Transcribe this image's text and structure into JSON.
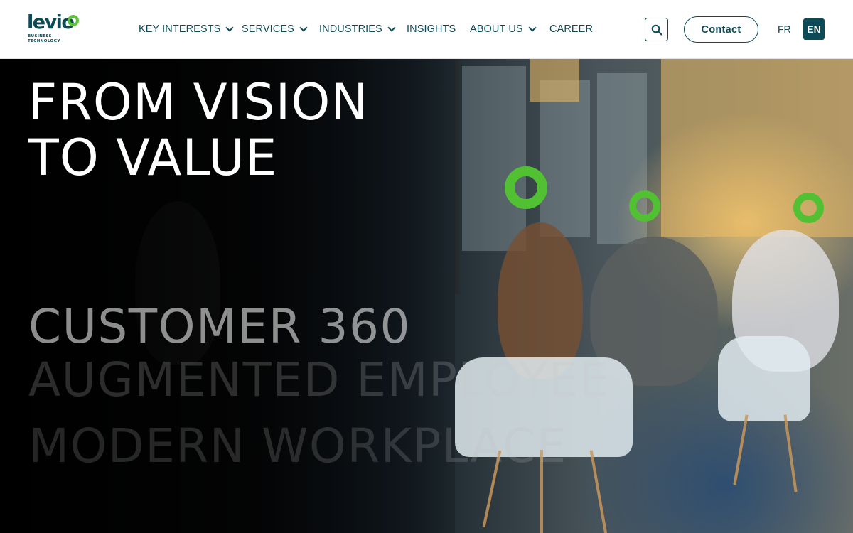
{
  "header": {
    "logo": {
      "word": "levio",
      "sub1": "BUSINESS +",
      "sub2": "TECHNOLOGY"
    },
    "nav": [
      {
        "label": "KEY INTERESTS",
        "has_dropdown": true
      },
      {
        "label": "SERVICES",
        "has_dropdown": true
      },
      {
        "label": "INDUSTRIES",
        "has_dropdown": true
      },
      {
        "label": "INSIGHTS",
        "has_dropdown": false
      },
      {
        "label": "ABOUT US",
        "has_dropdown": true
      },
      {
        "label": "CAREER",
        "has_dropdown": false
      }
    ],
    "search_icon": "search-icon",
    "contact_label": "Contact",
    "lang_fr": "FR",
    "lang_en": "EN"
  },
  "hero": {
    "headline_line1": "FROM VISION",
    "headline_line2": "TO VALUE",
    "rotating": [
      "CUSTOMER 360",
      "AUGMENTED EMPLOYEE",
      "MODERN WORKPLACE"
    ]
  },
  "colors": {
    "brand_dark": "#0d4a57",
    "brand_green": "#51c032",
    "header_bg": "#ffffff"
  }
}
